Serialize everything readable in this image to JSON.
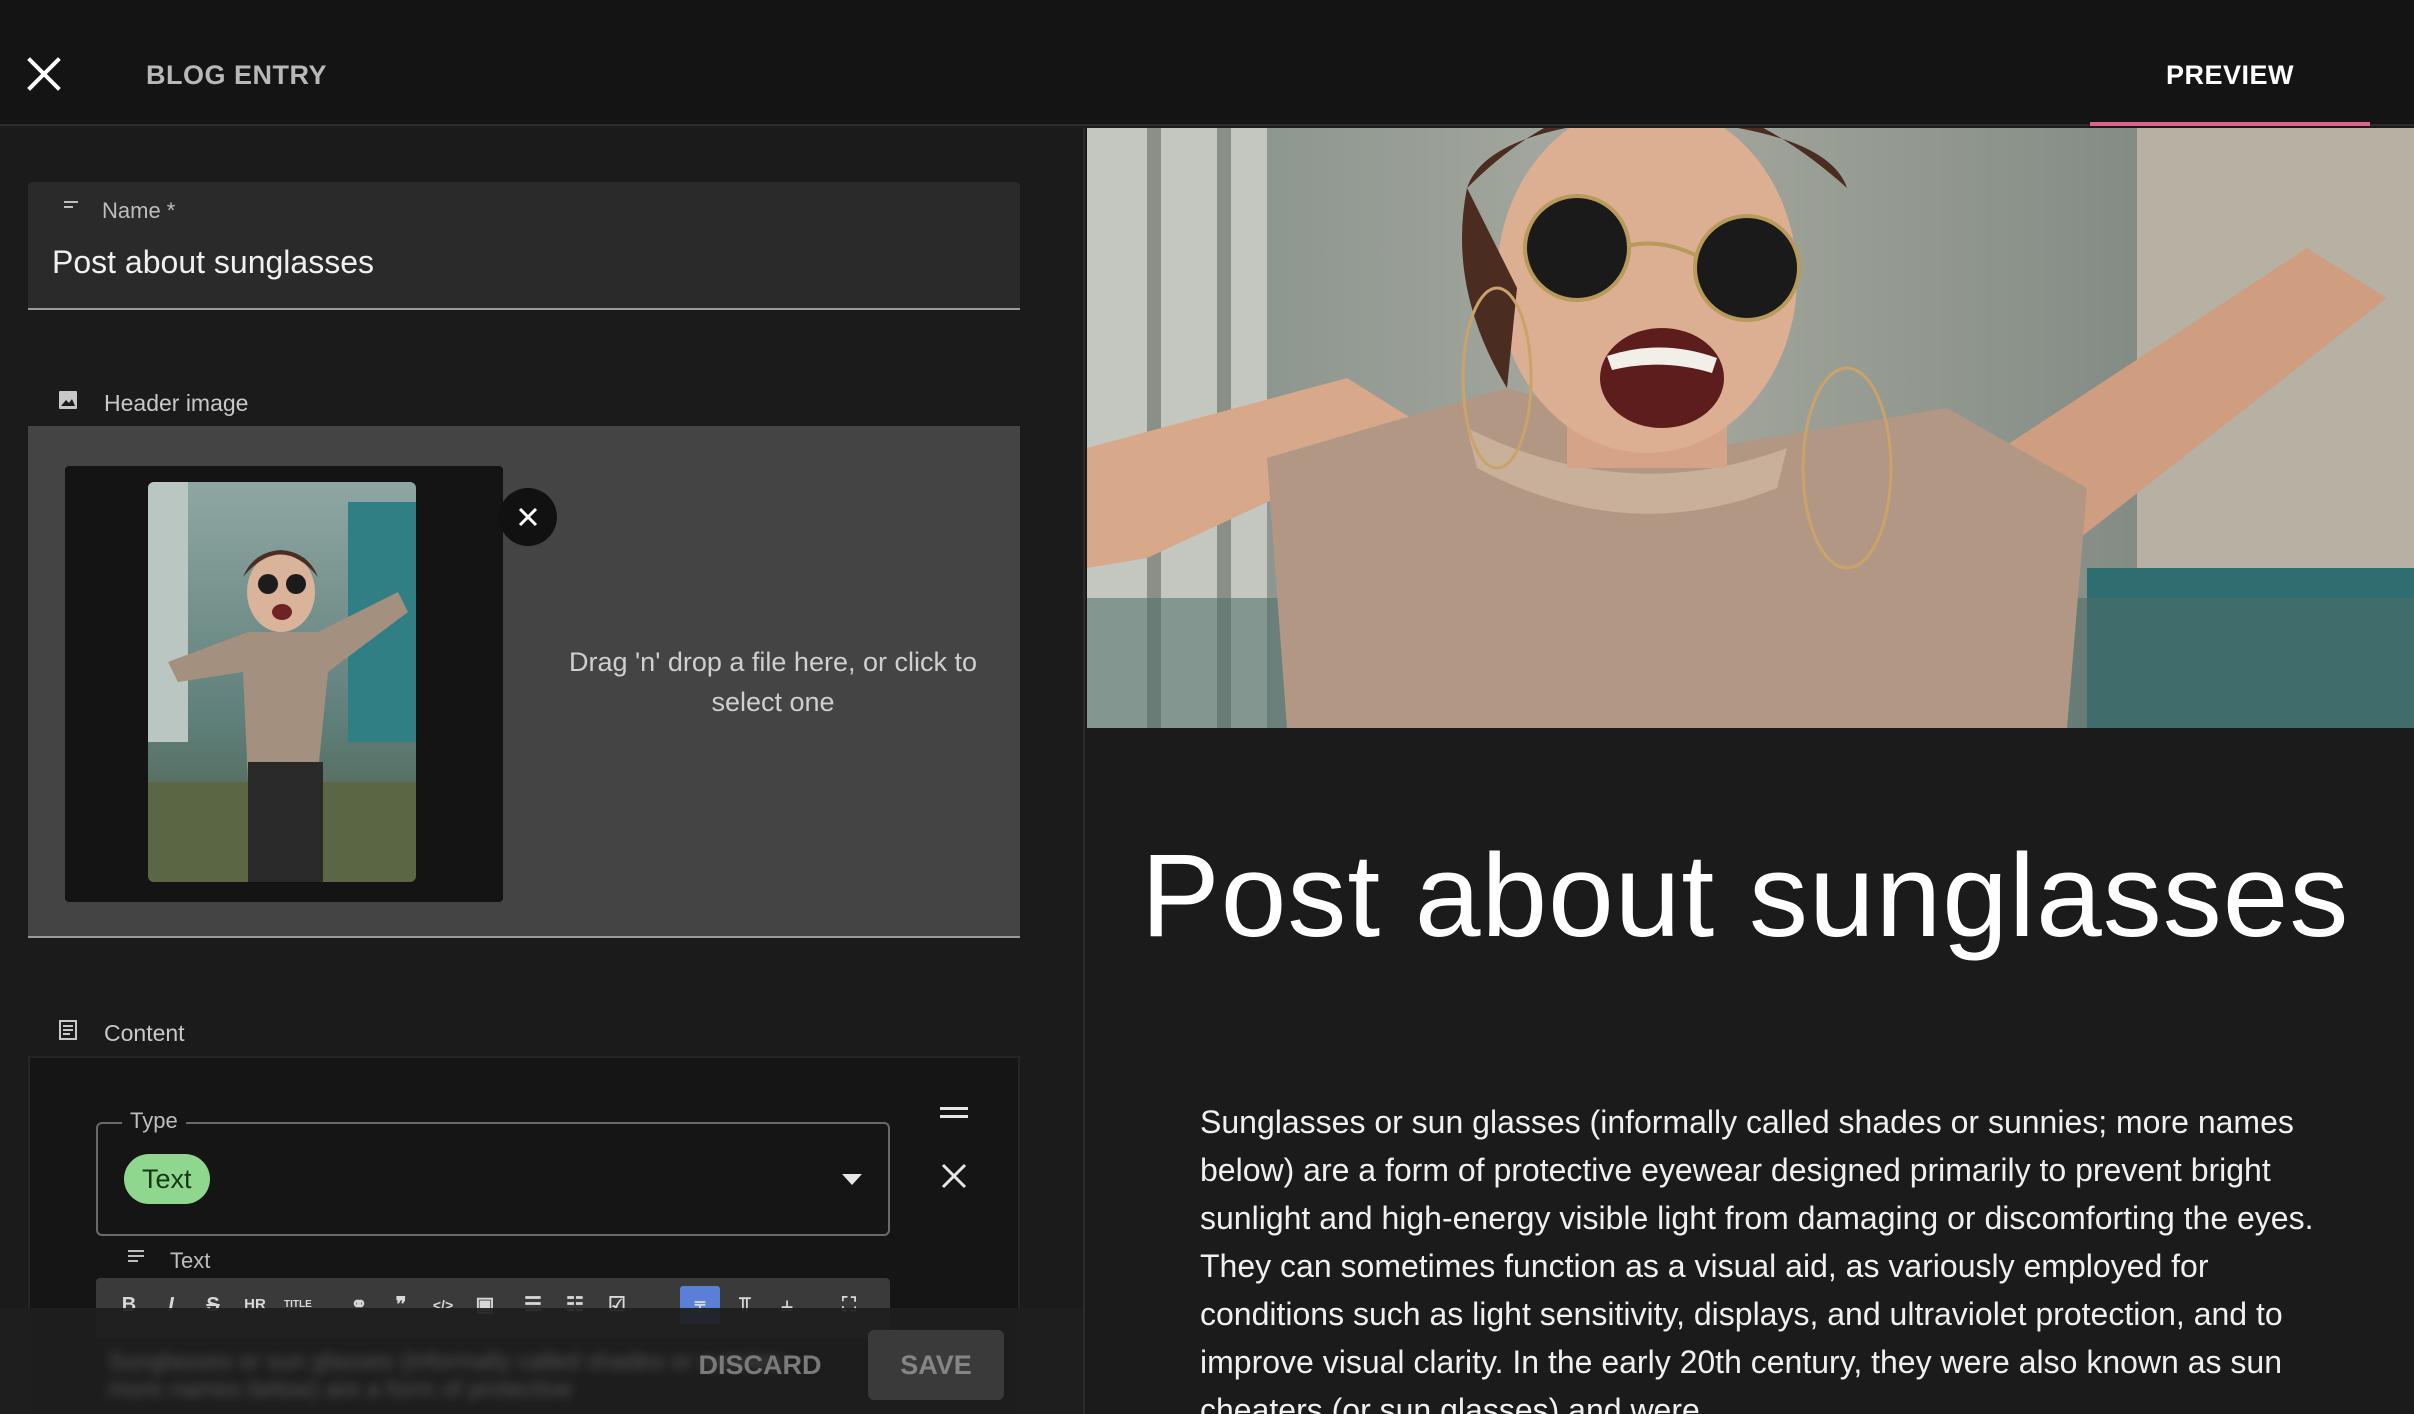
{
  "topbar": {
    "title": "BLOG ENTRY",
    "preview_tab": "PREVIEW",
    "accent": "#e0628a"
  },
  "form": {
    "name": {
      "label": "Name *",
      "value": "Post about sunglasses"
    },
    "header_image": {
      "label": "Header image",
      "dropzone_text": "Drag 'n' drop a file here, or click to select one"
    },
    "content": {
      "label": "Content",
      "type_label": "Type",
      "type_value": "Text",
      "text_label": "Text",
      "toolbar_items": [
        "B",
        "I",
        "S",
        "HR",
        "TITLE",
        "link",
        "quote",
        "code",
        "image",
        "ul",
        "ol",
        "checklist",
        "align-left",
        "align-center",
        "align-right",
        "fullscreen"
      ]
    },
    "actions": {
      "discard": "DISCARD",
      "save": "SAVE"
    }
  },
  "preview": {
    "title": "Post about sunglasses",
    "body": "Sunglasses or sun glasses (informally called shades or sunnies; more names below) are a form of protective eyewear designed primarily to prevent bright sunlight and high-energy visible light from damaging or discomforting the eyes. They can sometimes function as a visual aid, as variously employed for conditions such as light sensitivity, displays, and ultraviolet protection, and to improve visual clarity. In the early 20th century, they were also known as sun cheaters (or sun glasses) and were"
  }
}
